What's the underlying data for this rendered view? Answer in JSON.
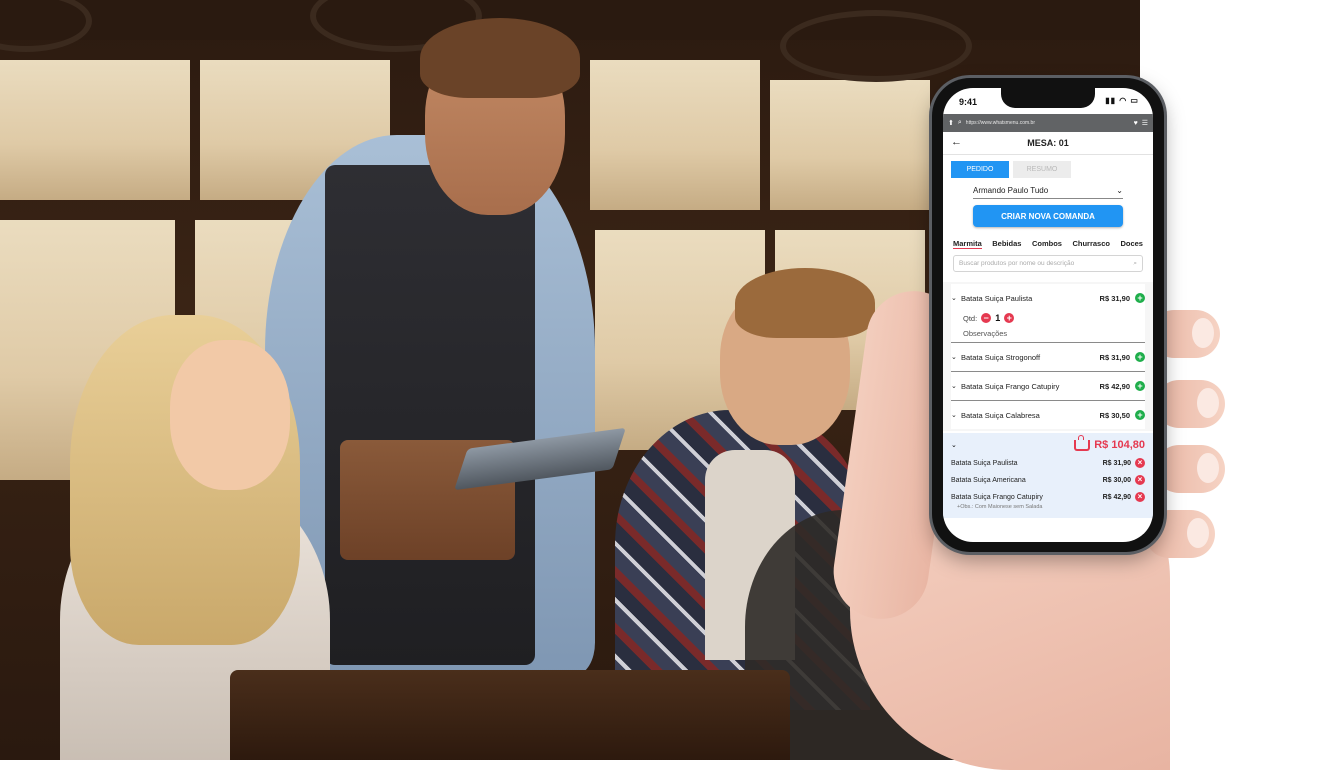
{
  "status": {
    "time": "9:41"
  },
  "browser": {
    "url": "https://www.whatsmenu.com.br"
  },
  "header": {
    "title": "MESA: 01"
  },
  "tabs": [
    {
      "label": "PEDIDO",
      "active": true
    },
    {
      "label": "RESUMO",
      "active": false
    }
  ],
  "customer_select": {
    "value": "Armando Paulo Tudo"
  },
  "create_button": {
    "label": "CRIAR NOVA COMANDA"
  },
  "categories": [
    "Marmita",
    "Bebidas",
    "Combos",
    "Churrasco",
    "Doces"
  ],
  "search": {
    "placeholder": "Buscar produtos por nome ou descrição"
  },
  "products": [
    {
      "name": "Batata Suiça Paulista",
      "price": "R$ 31,90",
      "expanded": true,
      "qty_label": "Qtd:",
      "qty": "1",
      "obs_label": "Observações"
    },
    {
      "name": "Batata Suiça Strogonoff",
      "price": "R$ 31,90"
    },
    {
      "name": "Batata Suiça Frango Catupiry",
      "price": "R$ 42,90"
    },
    {
      "name": "Batata Suiça Calabresa",
      "price": "R$ 30,50"
    }
  ],
  "summary": {
    "total": "R$ 104,80",
    "items": [
      {
        "name": "Batata Suiça Paulista",
        "price": "R$ 31,90"
      },
      {
        "name": "Batata Suiça Americana",
        "price": "R$ 30,00"
      },
      {
        "name": "Batata Suiça Frango Catupiry",
        "price": "R$ 42,90",
        "note": "+Obs.: Com Maionese sem Salada"
      }
    ]
  },
  "colors": {
    "primary": "#2195f3",
    "danger": "#e53950",
    "success": "#1fae4b"
  }
}
